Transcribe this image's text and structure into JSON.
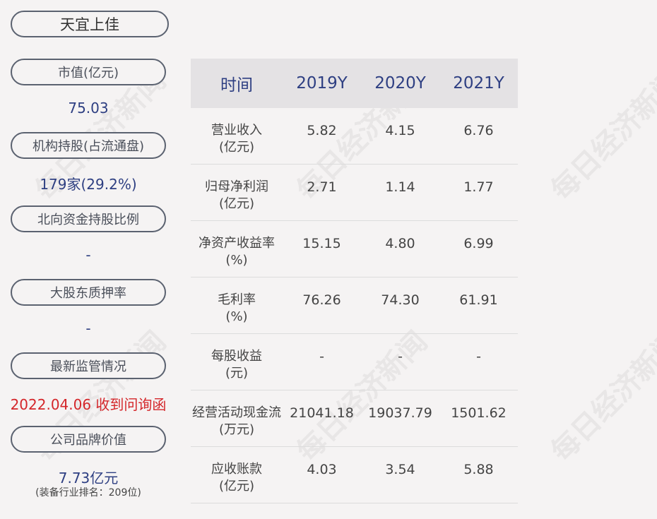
{
  "company": "天宜上佳",
  "left": {
    "market_cap": {
      "label": "市值(亿元)",
      "value": "75.03"
    },
    "institutions": {
      "label": "机构持股(占流通盘)",
      "value": "179家(29.2%)"
    },
    "northbound": {
      "label": "北向资金持股比例",
      "value": "-"
    },
    "pledge": {
      "label": "大股东质押率",
      "value": "-"
    },
    "regulation": {
      "label": "最新监管情况",
      "value": "2022.04.06 收到问询函"
    },
    "brand": {
      "label": "公司品牌价值",
      "value": "7.73亿元",
      "note": "(装备行业排名：209位)"
    }
  },
  "table": {
    "headers": [
      "时间",
      "2019Y",
      "2020Y",
      "2021Y"
    ],
    "rows": [
      {
        "label1": "营业收入",
        "label2": "(亿元)",
        "values": [
          "5.82",
          "4.15",
          "6.76"
        ]
      },
      {
        "label1": "归母净利润",
        "label2": "(亿元)",
        "values": [
          "2.71",
          "1.14",
          "1.77"
        ]
      },
      {
        "label1": "净资产收益率",
        "label2": "(%)",
        "values": [
          "15.15",
          "4.80",
          "6.99"
        ]
      },
      {
        "label1": "毛利率",
        "label2": "(%)",
        "values": [
          "76.26",
          "74.30",
          "61.91"
        ]
      },
      {
        "label1": "每股收益",
        "label2": "(元)",
        "values": [
          "-",
          "-",
          "-"
        ]
      },
      {
        "label1": "经营活动现金流",
        "label2": "(万元)",
        "values": [
          "21041.18",
          "19037.79",
          "1501.62"
        ]
      },
      {
        "label1": "应收账款",
        "label2": "(亿元)",
        "values": [
          "4.03",
          "3.54",
          "5.88"
        ]
      }
    ]
  },
  "watermark": "每日经济新闻"
}
